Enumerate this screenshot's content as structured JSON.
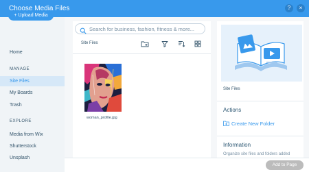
{
  "window": {
    "title": "Choose Media Files",
    "help_glyph": "?",
    "close_glyph": "×"
  },
  "sidebar": {
    "upload_label": "+ Upload Media",
    "home_label": "Home",
    "manage_heading": "MANAGE",
    "manage_items": [
      "Site Files",
      "My Boards",
      "Trash"
    ],
    "explore_heading": "EXPLORE",
    "explore_items": [
      "Media from Wix",
      "Shutterstock",
      "Unsplash"
    ]
  },
  "main": {
    "search_placeholder": "Search for business, fashion, fitness & more...",
    "breadcrumb": "Site Files",
    "toolbar_icons": [
      "new-folder-icon",
      "filter-icon",
      "sort-icon",
      "grid-view-icon"
    ],
    "files": [
      {
        "name": "woman_profile.jpg",
        "icon": "image-thumbnail"
      }
    ]
  },
  "right_panel": {
    "preview_icon": "media-illustration-icon",
    "folder_label": "Site Files",
    "actions_heading": "Actions",
    "create_folder_label": "Create New Folder",
    "information_heading": "Information",
    "information_text": "Organize site files and folders added"
  },
  "footer": {
    "add_button_label": "Add to Page"
  },
  "colors": {
    "accent": "#3899ec",
    "sidebar_bg": "#f0f4f7",
    "disabled_button": "#bcbcbc"
  }
}
